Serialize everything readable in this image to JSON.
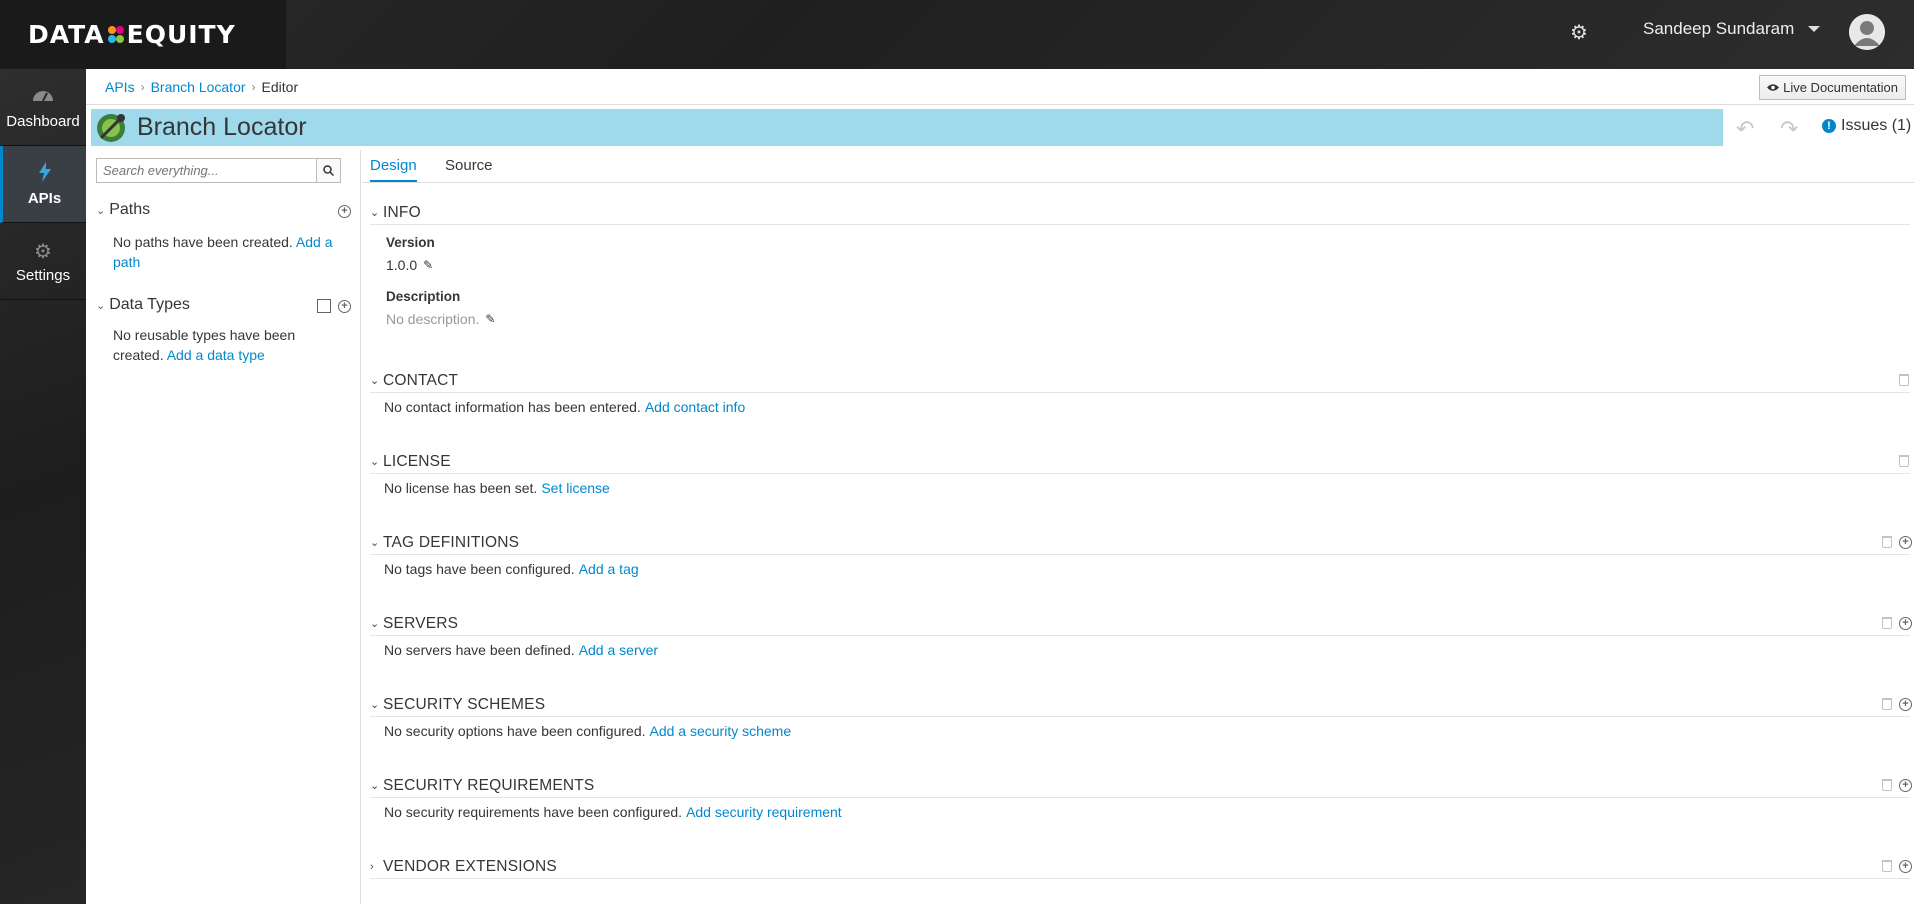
{
  "header": {
    "brand_left": "DATA",
    "brand_right": "EQUITY",
    "user_name": "Sandeep Sundaram",
    "icons": [
      "gear-icon",
      "caret-down-icon",
      "user-avatar-icon"
    ]
  },
  "nav": {
    "items": [
      {
        "label": "Dashboard",
        "icon": "dashboard-icon"
      },
      {
        "label": "APIs",
        "icon": "bolt-icon"
      },
      {
        "label": "Settings",
        "icon": "gears-icon"
      }
    ]
  },
  "breadcrumb": {
    "items": [
      "APIs",
      "Branch Locator",
      "Editor"
    ]
  },
  "toolbar": {
    "live_doc_label": "Live Documentation",
    "issues_label": "Issues (1)"
  },
  "api": {
    "title": "Branch Locator"
  },
  "search": {
    "placeholder": "Search everything..."
  },
  "left": {
    "paths_title": "Paths",
    "paths_empty": "No paths have been created.",
    "paths_add": "Add a path",
    "types_title": "Data Types",
    "types_empty": "No reusable types have been created.",
    "types_add": "Add a data type"
  },
  "tabs": [
    "Design",
    "Source"
  ],
  "info": {
    "title": "INFO",
    "version_label": "Version",
    "version_value": "1.0.0",
    "description_label": "Description",
    "description_value": "No description."
  },
  "sections": [
    {
      "title": "CONTACT",
      "empty": "No contact information has been entered.",
      "action": "Add contact info"
    },
    {
      "title": "LICENSE",
      "empty": "No license has been set.",
      "action": "Set license"
    },
    {
      "title": "TAG DEFINITIONS",
      "empty": "No tags have been configured.",
      "action": "Add a tag"
    },
    {
      "title": "SERVERS",
      "empty": "No servers have been defined.",
      "action": "Add a server"
    },
    {
      "title": "SECURITY SCHEMES",
      "empty": "No security options have been configured.",
      "action": "Add a security scheme"
    },
    {
      "title": "SECURITY REQUIREMENTS",
      "empty": "No security requirements have been configured.",
      "action": "Add security requirement"
    },
    {
      "title": "VENDOR EXTENSIONS"
    }
  ],
  "colors": {
    "accent": "#0088ce",
    "title_bar": "#9fd9ec",
    "header_bg": "#1f1f1f"
  }
}
